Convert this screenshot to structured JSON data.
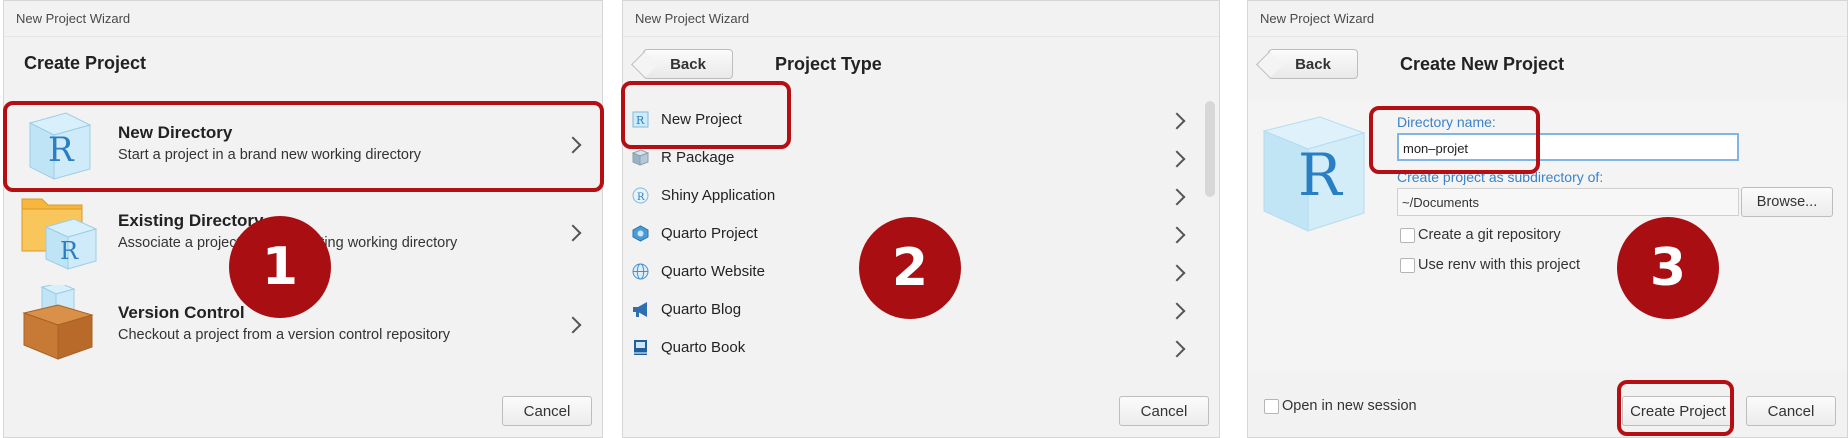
{
  "panel1": {
    "window_title": "New Project Wizard",
    "heading": "Create Project",
    "items": [
      {
        "title": "New Directory",
        "desc": "Start a project in a brand new working directory"
      },
      {
        "title": "Existing Directory",
        "desc": "Associate a project with an existing working directory"
      },
      {
        "title": "Version Control",
        "desc": "Checkout a project from a version control repository"
      }
    ],
    "cancel_label": "Cancel",
    "step": "1"
  },
  "panel2": {
    "window_title": "New Project Wizard",
    "back_label": "Back",
    "heading": "Project Type",
    "types": [
      {
        "label": "New Project",
        "icon": "r-project-icon"
      },
      {
        "label": "R Package",
        "icon": "r-package-icon"
      },
      {
        "label": "Shiny Application",
        "icon": "shiny-icon"
      },
      {
        "label": "Quarto Project",
        "icon": "quarto-icon"
      },
      {
        "label": "Quarto Website",
        "icon": "globe-icon"
      },
      {
        "label": "Quarto Blog",
        "icon": "megaphone-icon"
      },
      {
        "label": "Quarto Book",
        "icon": "book-icon"
      }
    ],
    "cancel_label": "Cancel",
    "step": "2"
  },
  "panel3": {
    "window_title": "New Project Wizard",
    "back_label": "Back",
    "heading": "Create New Project",
    "dir_label": "Directory name:",
    "dir_value": "mon–projet",
    "subdir_label": "Create project as subdirectory of:",
    "subdir_value": "~/Documents",
    "browse_label": "Browse...",
    "git_label": "Create a git repository",
    "renv_label": "Use renv with this project",
    "new_session_label": "Open in new session",
    "create_label": "Create Project",
    "cancel_label": "Cancel",
    "step": "3"
  },
  "colors": {
    "highlight": "#b50f14",
    "step_badge": "#a80e12",
    "link_blue": "#3b82c9"
  }
}
